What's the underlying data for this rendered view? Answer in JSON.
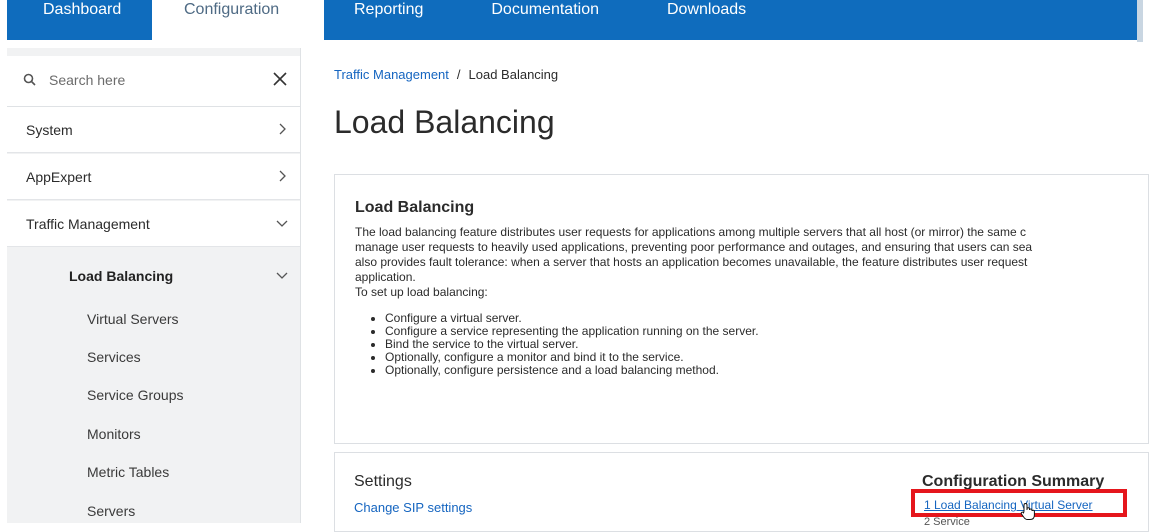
{
  "nav": {
    "tabs": [
      {
        "label": "Dashboard"
      },
      {
        "label": "Configuration"
      },
      {
        "label": "Reporting"
      },
      {
        "label": "Documentation"
      },
      {
        "label": "Downloads"
      }
    ],
    "active_tab": "Configuration"
  },
  "sidebar": {
    "search": {
      "placeholder": "Search here"
    },
    "items": [
      {
        "label": "System"
      },
      {
        "label": "AppExpert"
      },
      {
        "label": "Traffic Management"
      },
      {
        "label": "Load Balancing"
      }
    ],
    "sub_items": [
      {
        "label": "Virtual Servers"
      },
      {
        "label": "Services"
      },
      {
        "label": "Service Groups"
      },
      {
        "label": "Monitors"
      },
      {
        "label": "Metric Tables"
      },
      {
        "label": "Servers"
      }
    ]
  },
  "breadcrumb": {
    "parent": "Traffic Management",
    "separator": "/",
    "current": "Load Balancing"
  },
  "page_title": "Load Balancing",
  "intro": {
    "title": "Load Balancing",
    "lines": [
      "The load balancing feature distributes user requests for applications among multiple servers that all host (or mirror) the same c",
      "manage user requests to heavily used applications, preventing poor performance and outages, and ensuring that users can sea",
      "also provides fault tolerance: when a server that hosts an application becomes unavailable, the feature distributes user request",
      "application.",
      "To set up load balancing:"
    ],
    "steps": [
      "Configure a virtual server.",
      "Configure a service representing the application running on the server.",
      "Bind the service to the virtual server.",
      "Optionally, configure a monitor and bind it to the service.",
      "Optionally, configure persistence and a load balancing method."
    ]
  },
  "settings": {
    "title": "Settings",
    "link": "Change SIP settings"
  },
  "summary": {
    "title": "Configuration Summary",
    "link": "1 Load Balancing Virtual Server",
    "next": "2 Service"
  },
  "colors": {
    "nav_blue": "#0f6cbd",
    "link_blue": "#1565c0",
    "highlight_red": "#e5161c"
  }
}
